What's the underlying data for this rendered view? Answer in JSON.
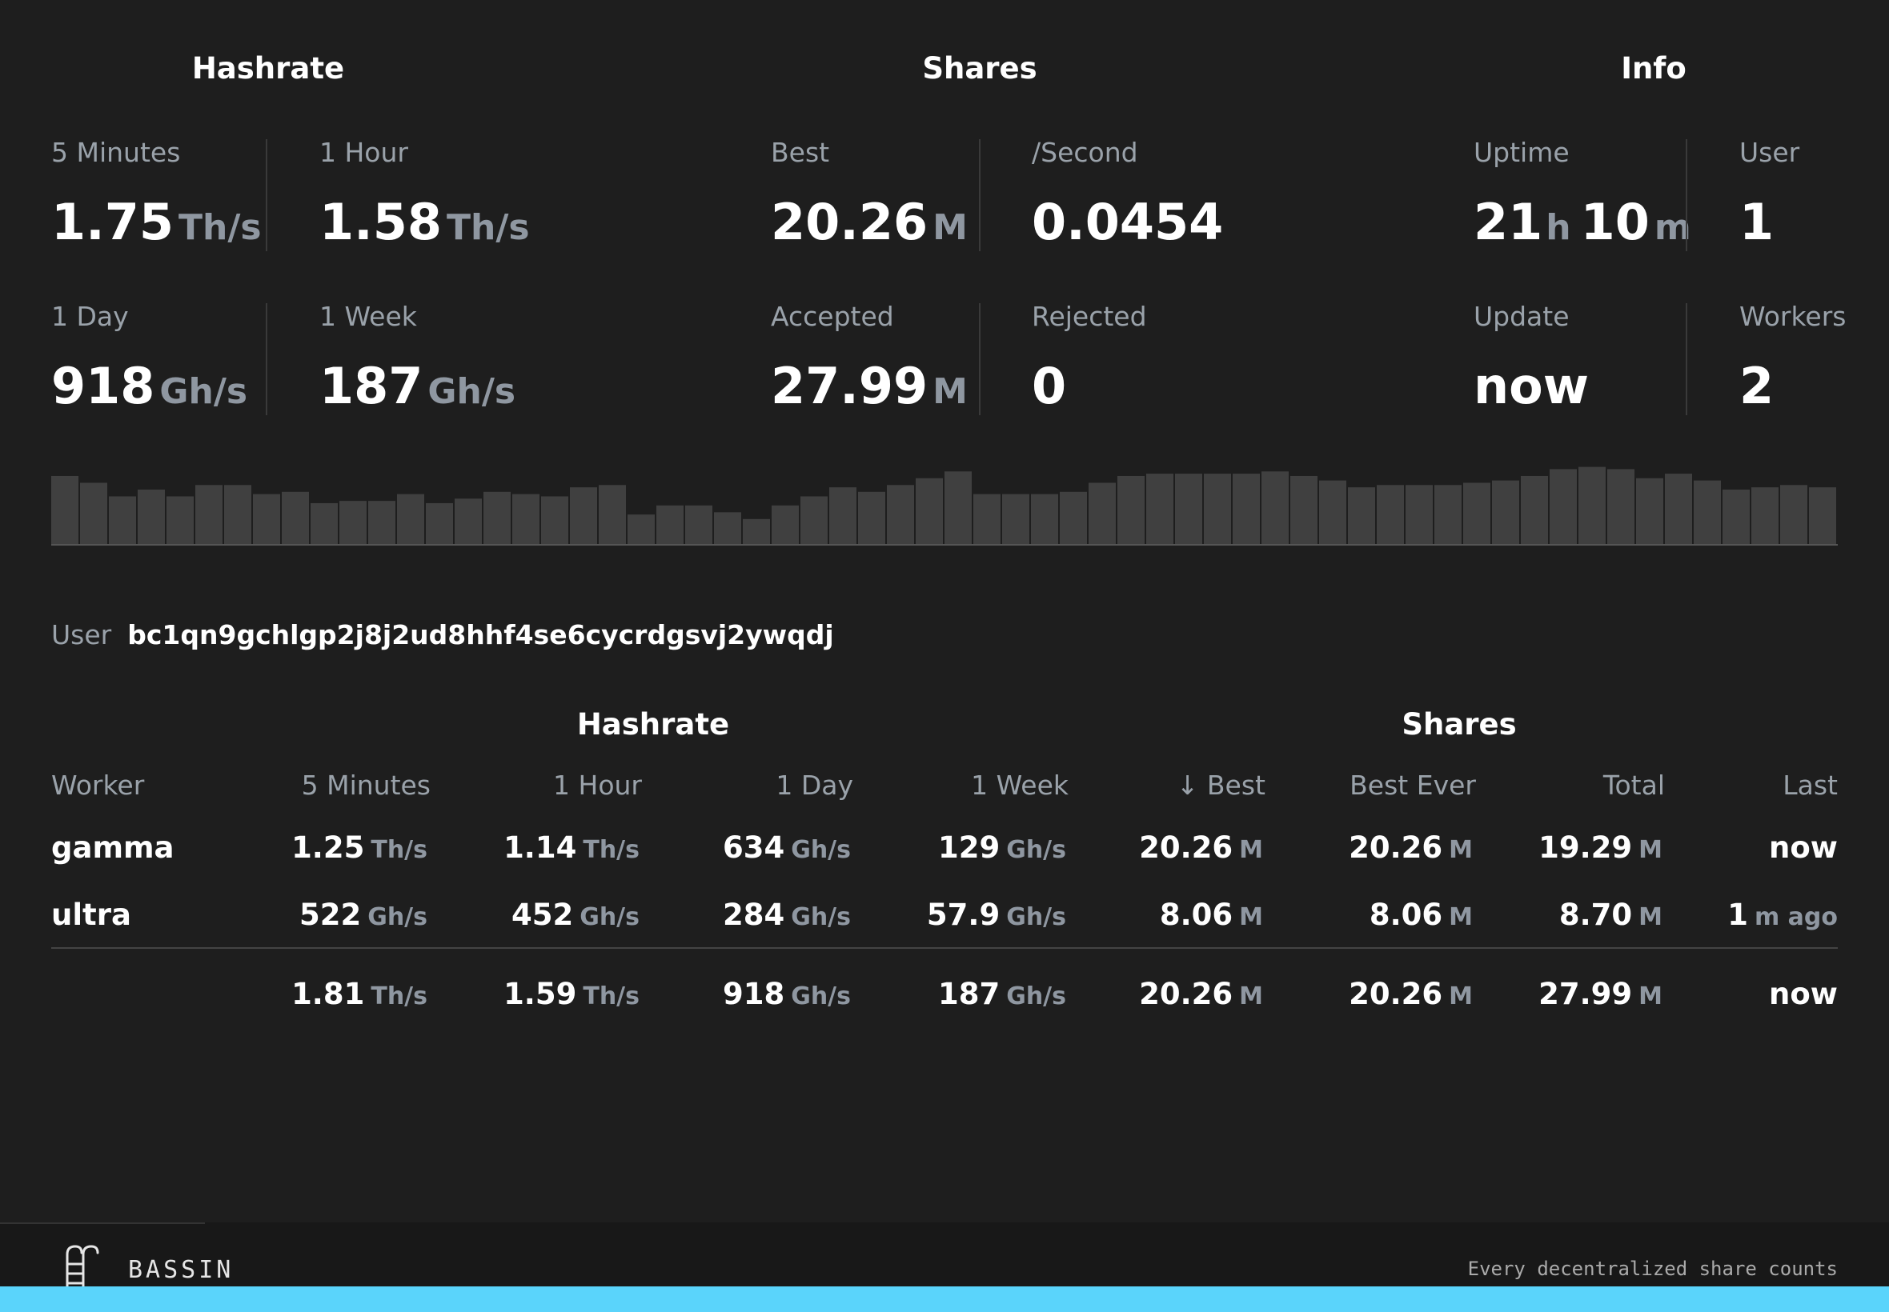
{
  "overview": {
    "hashrate": {
      "title": "Hashrate",
      "m5": {
        "label": "5 Minutes",
        "value": "1.75",
        "unit": "Th/s"
      },
      "h1": {
        "label": "1 Hour",
        "value": "1.58",
        "unit": "Th/s"
      },
      "d1": {
        "label": "1 Day",
        "value": "918",
        "unit": "Gh/s"
      },
      "w1": {
        "label": "1 Week",
        "value": "187",
        "unit": "Gh/s"
      }
    },
    "shares": {
      "title": "Shares",
      "best": {
        "label": "Best",
        "value": "20.26",
        "unit": "M"
      },
      "per_second": {
        "label": "/Second",
        "value": "0.0454"
      },
      "accepted": {
        "label": "Accepted",
        "value": "27.99",
        "unit": "M"
      },
      "rejected": {
        "label": "Rejected",
        "value": "0"
      }
    },
    "info": {
      "title": "Info",
      "uptime": {
        "label": "Uptime",
        "h": "21",
        "h_unit": "h",
        "m": "10",
        "m_unit": "m"
      },
      "user": {
        "label": "User",
        "value": "1"
      },
      "update": {
        "label": "Update",
        "value": "now"
      },
      "workers": {
        "label": "Workers",
        "value": "2"
      }
    }
  },
  "sparkline": [
    30,
    27,
    21,
    24,
    21,
    26,
    26,
    22,
    23,
    18,
    19,
    19,
    22,
    18,
    20,
    23,
    22,
    21,
    25,
    26,
    13,
    17,
    17,
    14,
    11,
    17,
    21,
    25,
    23,
    26,
    29,
    32,
    22,
    22,
    22,
    23,
    27,
    30,
    31,
    31,
    31,
    31,
    32,
    30,
    28,
    25,
    26,
    26,
    26,
    27,
    28,
    30,
    33,
    34,
    33,
    29,
    31,
    28,
    24,
    25,
    26,
    25
  ],
  "user": {
    "label": "User",
    "address": "bc1qn9gchlgp2j8j2ud8hhf4se6cycrdgsvj2ywqdj"
  },
  "table": {
    "group_hashrate": "Hashrate",
    "group_shares": "Shares",
    "headers": {
      "worker": "Worker",
      "m5": "5 Minutes",
      "h1": "1 Hour",
      "d1": "1 Day",
      "w1": "1 Week",
      "best": "↓ Best",
      "best_ever": "Best Ever",
      "total": "Total",
      "last": "Last"
    },
    "rows": [
      {
        "worker": "gamma",
        "m5": {
          "v": "1.25",
          "u": "Th/s"
        },
        "h1": {
          "v": "1.14",
          "u": "Th/s"
        },
        "d1": {
          "v": "634",
          "u": "Gh/s"
        },
        "w1": {
          "v": "129",
          "u": "Gh/s"
        },
        "best": {
          "v": "20.26",
          "u": "M"
        },
        "best_ever": {
          "v": "20.26",
          "u": "M"
        },
        "total": {
          "v": "19.29",
          "u": "M"
        },
        "last": {
          "v": "now"
        }
      },
      {
        "worker": "ultra",
        "m5": {
          "v": "522",
          "u": "Gh/s"
        },
        "h1": {
          "v": "452",
          "u": "Gh/s"
        },
        "d1": {
          "v": "284",
          "u": "Gh/s"
        },
        "w1": {
          "v": "57.9",
          "u": "Gh/s"
        },
        "best": {
          "v": "8.06",
          "u": "M"
        },
        "best_ever": {
          "v": "8.06",
          "u": "M"
        },
        "total": {
          "v": "8.70",
          "u": "M"
        },
        "last": {
          "v": "1",
          "u": "m ago"
        }
      }
    ],
    "totals": {
      "m5": {
        "v": "1.81",
        "u": "Th/s"
      },
      "h1": {
        "v": "1.59",
        "u": "Th/s"
      },
      "d1": {
        "v": "918",
        "u": "Gh/s"
      },
      "w1": {
        "v": "187",
        "u": "Gh/s"
      },
      "best": {
        "v": "20.26",
        "u": "M"
      },
      "best_ever": {
        "v": "20.26",
        "u": "M"
      },
      "total": {
        "v": "27.99",
        "u": "M"
      },
      "last": {
        "v": "now"
      }
    }
  },
  "footer": {
    "brand": "BASSIN",
    "tagline": "Every decentralized share counts",
    "accent": "#5ad4fb"
  },
  "colors": {
    "background": "#1e1e1e",
    "muted": "#9aa2aa",
    "bar": "#404040"
  }
}
